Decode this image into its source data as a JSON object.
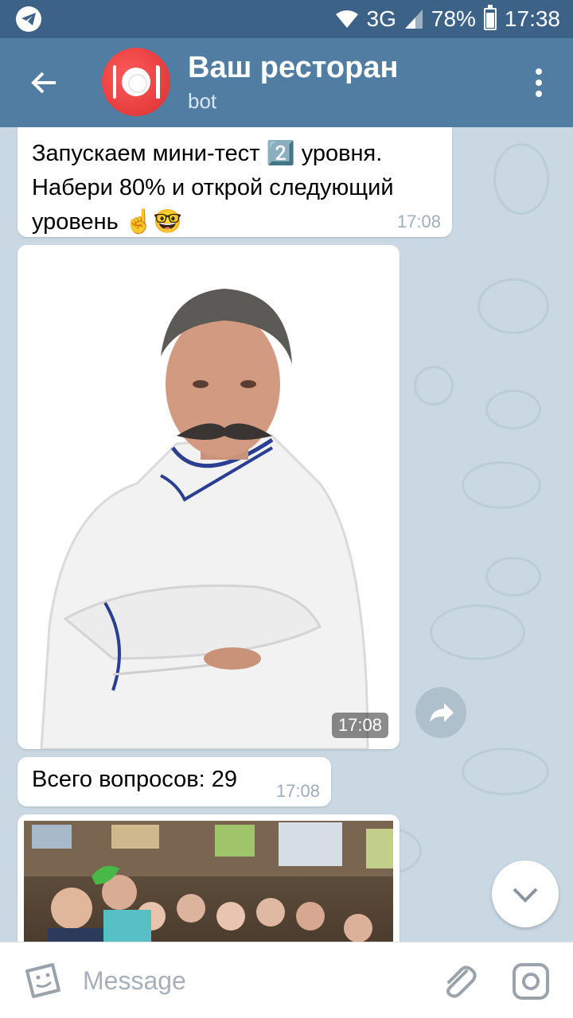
{
  "status_bar": {
    "network": "3G",
    "battery": "78%",
    "battery_level": 0.78,
    "time": "17:38",
    "icons": [
      "telegram-notification-icon",
      "wifi-icon",
      "signal-icon",
      "battery-icon"
    ]
  },
  "header": {
    "title": "Ваш ресторан",
    "subtitle": "bot",
    "icons": [
      "back-arrow-icon",
      "more-vert-icon"
    ]
  },
  "messages": [
    {
      "type": "text",
      "text": "Запускаем мини-тест 2️⃣ уровня. Набери 80% и открой следующий уровень ☝️🤓",
      "time": "17:08"
    },
    {
      "type": "photo",
      "description": "chef-portrait",
      "time": "17:08"
    },
    {
      "type": "text",
      "text": "Всего вопросов: 29",
      "time": "17:08"
    },
    {
      "type": "photo",
      "description": "group-photo"
    }
  ],
  "composer": {
    "placeholder": "Message",
    "icons": [
      "sticker-icon",
      "attach-icon",
      "camera-icon"
    ]
  },
  "colors": {
    "status_bar": "#3c6288",
    "app_bar": "#517da2",
    "chat_bg": "#c9d8e2",
    "bubble": "#ffffff",
    "time_text": "#a0acb6"
  }
}
